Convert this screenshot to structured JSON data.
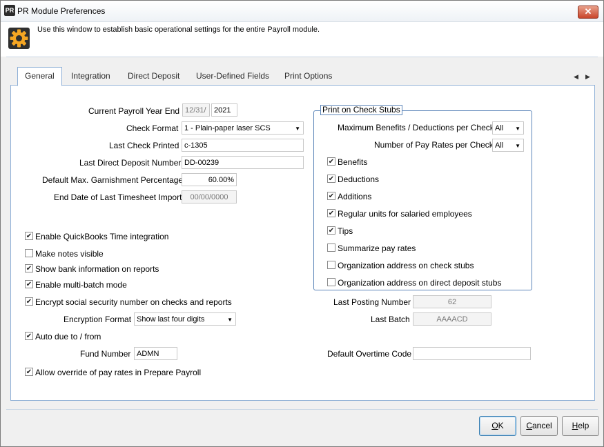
{
  "window": {
    "title": "PR Module Preferences",
    "app_badge": "PR",
    "close_symbol": "✕"
  },
  "header": {
    "description": "Use this window to establish basic operational settings for the entire Payroll module."
  },
  "tabs": [
    {
      "label": "General"
    },
    {
      "label": "Integration"
    },
    {
      "label": "Direct Deposit"
    },
    {
      "label": "User-Defined Fields"
    },
    {
      "label": "Print Options"
    }
  ],
  "tab_nav": {
    "prev": "◀",
    "next": "▶"
  },
  "general": {
    "payroll_year_end": {
      "label": "Current Payroll Year End",
      "date": "12/31/",
      "year": "2021"
    },
    "check_format": {
      "label": "Check Format",
      "value": "1 - Plain-paper laser SCS"
    },
    "last_check_printed": {
      "label": "Last Check Printed",
      "value": "c-1305"
    },
    "last_direct_deposit": {
      "label": "Last Direct Deposit Number",
      "value": "DD-00239"
    },
    "garnishment_pct": {
      "label": "Default Max. Garnishment Percentage",
      "value": "60.00%"
    },
    "last_timesheet_import": {
      "label": "End Date of Last Timesheet Import",
      "value": "00/00/0000"
    },
    "enable_qb_time": {
      "label": "Enable QuickBooks Time integration",
      "checked": true
    },
    "notes_visible": {
      "label": "Make notes visible",
      "checked": false
    },
    "show_bank_info": {
      "label": "Show bank information on reports",
      "checked": true
    },
    "multi_batch": {
      "label": "Enable multi-batch mode",
      "checked": true
    },
    "encrypt_ssn": {
      "label": "Encrypt social security number on checks and reports",
      "checked": true
    },
    "encryption_format": {
      "label": "Encryption Format",
      "value": "Show last four digits"
    },
    "auto_due": {
      "label": "Auto due to / from",
      "checked": true
    },
    "fund_number": {
      "label": "Fund Number",
      "value": "ADMN"
    },
    "allow_override": {
      "label": "Allow override of pay rates in Prepare Payroll",
      "checked": true
    },
    "last_posting_number": {
      "label": "Last Posting Number",
      "value": "62"
    },
    "last_batch": {
      "label": "Last Batch",
      "value": "AAAACD"
    },
    "default_overtime_code": {
      "label": "Default Overtime Code",
      "value": ""
    }
  },
  "print_on_stubs": {
    "title": "Print on Check Stubs",
    "max_benefits": {
      "label": "Maximum Benefits / Deductions per Check",
      "value": "All"
    },
    "num_pay_rates": {
      "label": "Number of Pay Rates per Check",
      "value": "All"
    },
    "options": [
      {
        "label": "Benefits",
        "checked": true
      },
      {
        "label": "Deductions",
        "checked": true
      },
      {
        "label": "Additions",
        "checked": true
      },
      {
        "label": "Regular units for salaried employees",
        "checked": true
      },
      {
        "label": "Tips",
        "checked": true
      },
      {
        "label": "Summarize pay rates",
        "checked": false
      },
      {
        "label": "Organization address on check stubs",
        "checked": false
      },
      {
        "label": "Organization address on direct deposit stubs",
        "checked": false
      }
    ]
  },
  "buttons": {
    "ok": {
      "underlined": "O",
      "rest": "K"
    },
    "cancel": {
      "underlined": "C",
      "rest": "ancel"
    },
    "help": {
      "underlined": "H",
      "rest": "elp"
    }
  },
  "dropdown_arrow": "▼"
}
